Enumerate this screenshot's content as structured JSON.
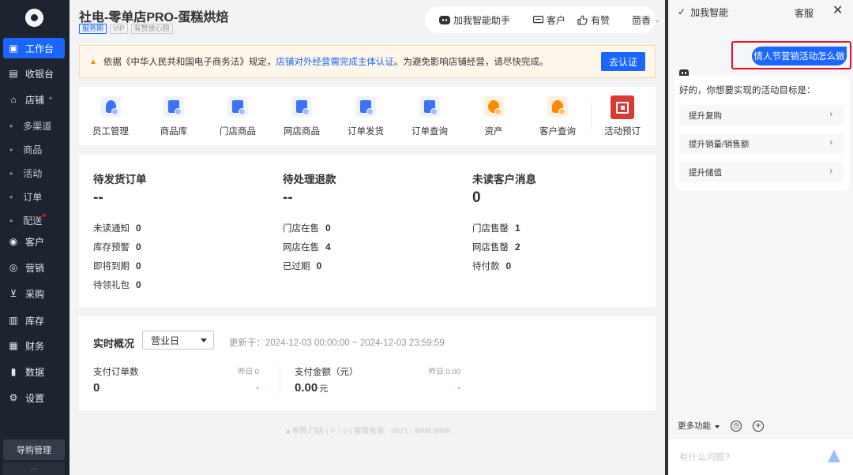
{
  "sidebar": {
    "items": [
      {
        "label": "工作台",
        "icon": "workbench-icon",
        "glyph": "▣"
      },
      {
        "label": "收银台",
        "icon": "cashier-icon",
        "glyph": "▤"
      },
      {
        "label": "店铺",
        "icon": "store-icon",
        "glyph": "⌂"
      },
      {
        "label": "客户",
        "icon": "customer-icon",
        "glyph": "◉"
      },
      {
        "label": "营销",
        "icon": "marketing-icon",
        "glyph": "◎"
      },
      {
        "label": "采购",
        "icon": "cart-icon",
        "glyph": "⊻"
      },
      {
        "label": "库存",
        "icon": "warehouse-icon",
        "glyph": "▥"
      },
      {
        "label": "财务",
        "icon": "finance-icon",
        "glyph": "▦"
      },
      {
        "label": "数据",
        "icon": "chart-icon",
        "glyph": "▮"
      },
      {
        "label": "设置",
        "icon": "gear-icon",
        "glyph": "⚙"
      }
    ],
    "store_submenu": [
      "多渠道",
      "商品",
      "活动",
      "订单",
      "配送"
    ],
    "store_expand_glyph": "^",
    "guide_button": "导购管理",
    "more": "..."
  },
  "header": {
    "title": "社电-零单店PRO-蛋糕烘焙",
    "tags": [
      "服务期",
      "VIP",
      "有赞放心购"
    ],
    "tools": {
      "assistant": "加我智能助手",
      "customer": "客户",
      "youzan": "有赞",
      "user": "茴香",
      "user_caret": "⌄"
    }
  },
  "notice": {
    "text_before": "依据《中华人民共和国电子商务法》规定，",
    "link": "店铺对外经营需完成主体认证",
    "text_after": "。为避免影响店铺经营，请尽快完成。",
    "button": "去认证"
  },
  "shortcuts": [
    {
      "label": "员工管理",
      "icon": "staff-icon"
    },
    {
      "label": "商品库",
      "icon": "product-library-icon"
    },
    {
      "label": "门店商品",
      "icon": "store-product-icon"
    },
    {
      "label": "网店商品",
      "icon": "online-product-icon"
    },
    {
      "label": "订单发货",
      "icon": "order-ship-icon"
    },
    {
      "label": "订单查询",
      "icon": "order-search-icon"
    },
    {
      "label": "资产",
      "icon": "assets-icon"
    },
    {
      "label": "客户查询",
      "icon": "customer-search-icon"
    },
    {
      "label": "活动预订",
      "icon": "calendar-icon"
    }
  ],
  "todo": {
    "columns": [
      {
        "title": "待发货订单",
        "big": "--",
        "rows": [
          {
            "label": "未读通知",
            "value": "0"
          },
          {
            "label": "库存预警",
            "value": "0"
          },
          {
            "label": "即将到期",
            "value": "0"
          },
          {
            "label": "待领礼包",
            "value": "0"
          }
        ]
      },
      {
        "title": "待处理退款",
        "big": "--",
        "rows": [
          {
            "label": "门店在售",
            "value": "0"
          },
          {
            "label": "网店在售",
            "value": "4"
          },
          {
            "label": "已过期",
            "value": "0"
          }
        ]
      },
      {
        "title": "未读客户消息",
        "big": "0",
        "rows": [
          {
            "label": "门店售罄",
            "value": "1"
          },
          {
            "label": "网店售罄",
            "value": "2"
          },
          {
            "label": "待付款",
            "value": "0"
          }
        ]
      }
    ]
  },
  "realtime": {
    "title": "实时概况",
    "select_value": "营业日",
    "updated": "更新于：2024-12-03 00:00:00 ~ 2024-12-03 23:59:59",
    "metrics": [
      {
        "label": "支付订单数",
        "yesterday": "昨日 0",
        "value": "0",
        "unit": "",
        "diff": "-"
      },
      {
        "label": "支付金额（元）",
        "yesterday": "昨日 0.00",
        "value": "0.00",
        "unit": "元",
        "diff": "-"
      }
    ]
  },
  "footer": "▲有赞.门店 | V 7.0 | 客服电话：0571 - 8998 8848",
  "assistant": {
    "title": "加我智能",
    "title_glyph": "✓",
    "service": "客服",
    "close_glyph": "✕",
    "user_message": "情人节营销活动怎么做",
    "bot_text": "好的，你想要实现的活动目标是：",
    "options": [
      "提升复购",
      "提升销量/销售额",
      "提升储值"
    ],
    "chevron": "›",
    "more_features": "更多功能",
    "history_glyph": "◷",
    "add_glyph": "+",
    "input_placeholder": "有什么问题?"
  },
  "colors": {
    "brand": "#1a66ff",
    "sidebar_bg": "#1e2330",
    "warning": "#ff8a00",
    "danger": "#ee0a24"
  }
}
